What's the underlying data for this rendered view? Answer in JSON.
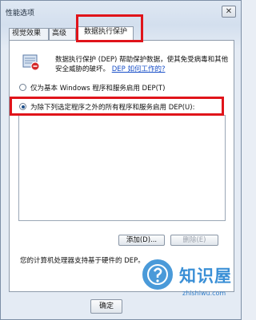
{
  "window": {
    "title": "性能选项",
    "close_glyph": "✕"
  },
  "tabs": [
    {
      "label": "视觉效果"
    },
    {
      "label": "高级"
    },
    {
      "label": "数据执行保护"
    }
  ],
  "dep": {
    "description": "数据执行保护 (DEP) 帮助保护数据，使其免受病毒和其他安全威胁的破坏。",
    "link": "DEP 如何工作的?",
    "option_basic": "仅为基本 Windows 程序和服务启用 DEP(T)",
    "option_all": "为除下列选定程序之外的所有程序和服务启用 DEP(U):",
    "selected_option": "option_all",
    "add_button": "添加(D)...",
    "remove_button": "删除(E)",
    "status": "您的计算机处理器支持基于硬件的 DEP。"
  },
  "footer": {
    "ok_button": "确定"
  },
  "watermark": {
    "brand": "知识屋",
    "url": "zhishiwu.com"
  },
  "colors": {
    "highlight": "#e0141a",
    "link": "#1a50c8",
    "brand": "#3a8fd6"
  }
}
